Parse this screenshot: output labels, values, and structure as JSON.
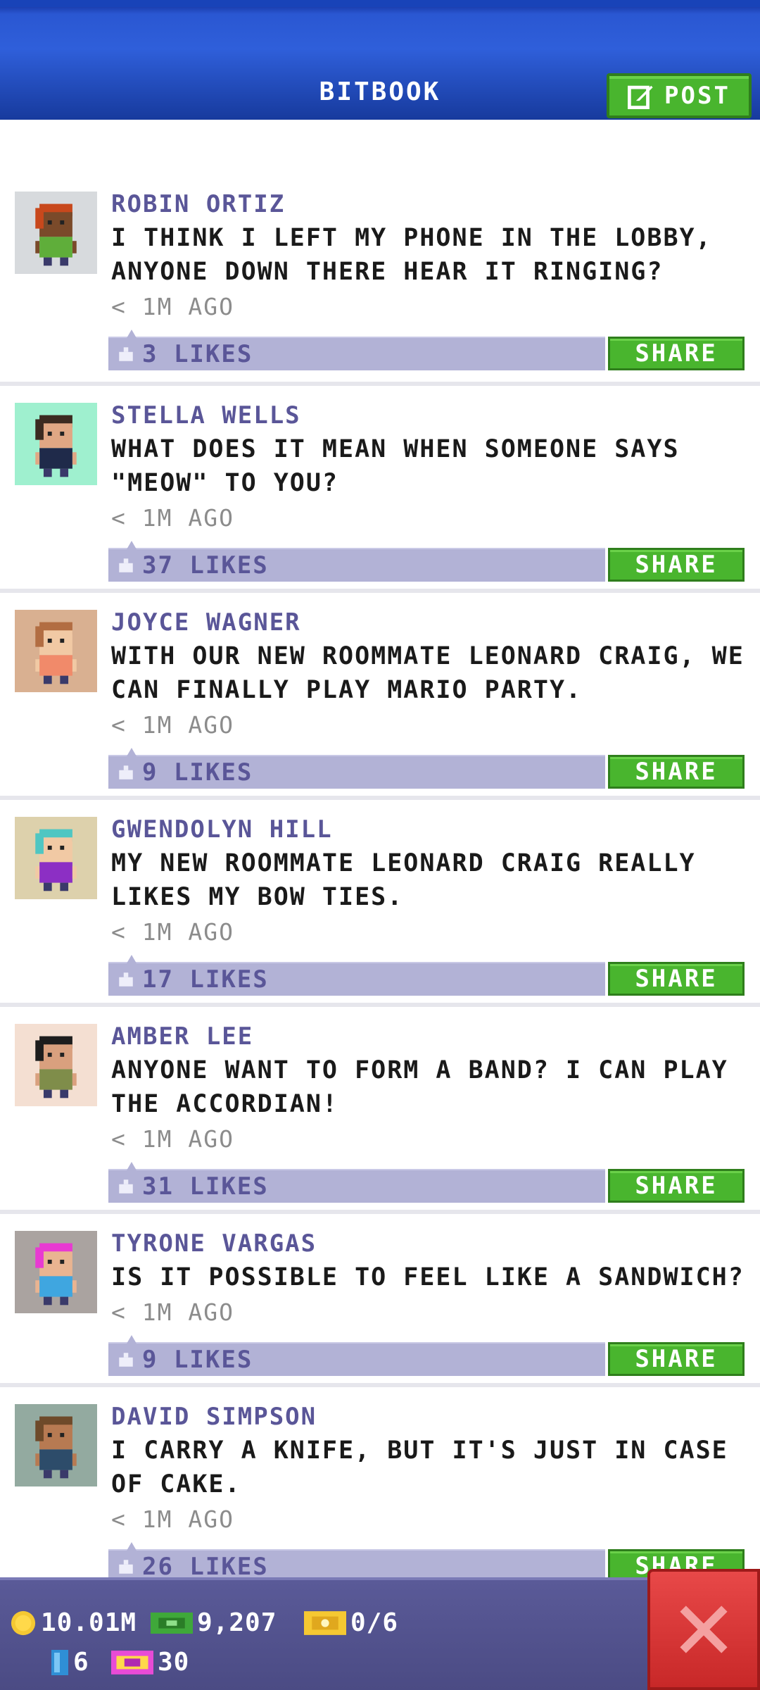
{
  "header": {
    "title": "BITBOOK",
    "post_label": "POST"
  },
  "share_label": "SHARE",
  "posts": [
    {
      "author": "ROBIN ORTIZ",
      "message": "I THINK I LEFT MY PHONE IN THE LOBBY, ANYONE DOWN THERE HEAR IT RINGING?",
      "time": "< 1M AGO",
      "likes": "3 LIKES",
      "avatar_bg": "#d7dadd",
      "hair": "#c8481c",
      "skin": "#7a4a2a",
      "shirt": "#5fae3a"
    },
    {
      "author": "STELLA WELLS",
      "message": "WHAT DOES IT MEAN WHEN SOMEONE SAYS \"MEOW\" TO YOU?",
      "time": "< 1M AGO",
      "likes": "37 LIKES",
      "avatar_bg": "#9ff0cf",
      "hair": "#3b2a20",
      "skin": "#e0a784",
      "shirt": "#1f2a4a"
    },
    {
      "author": "JOYCE WAGNER",
      "message": "WITH OUR NEW ROOMMATE LEONARD CRAIG, WE CAN FINALLY PLAY MARIO PARTY.",
      "time": "< 1M AGO",
      "likes": "9 LIKES",
      "avatar_bg": "#d9b091",
      "hair": "#b26d42",
      "skin": "#f1c9a4",
      "shirt": "#f18a6a"
    },
    {
      "author": "GWENDOLYN HILL",
      "message": "MY NEW ROOMMATE LEONARD CRAIG REALLY LIKES MY BOW TIES.",
      "time": "< 1M AGO",
      "likes": "17 LIKES",
      "avatar_bg": "#ddd1ac",
      "hair": "#4fc6c2",
      "skin": "#f1c9a4",
      "shirt": "#8c2fc4"
    },
    {
      "author": "AMBER LEE",
      "message": "ANYONE WANT TO FORM A BAND? I CAN PLAY THE ACCORDIAN!",
      "time": "< 1M AGO",
      "likes": "31 LIKES",
      "avatar_bg": "#f4dfd2",
      "hair": "#1d1d1d",
      "skin": "#d9a07e",
      "shirt": "#7f8d4a"
    },
    {
      "author": "TYRONE VARGAS",
      "message": "IS IT POSSIBLE TO FEEL LIKE A SANDWICH?",
      "time": "< 1M AGO",
      "likes": "9 LIKES",
      "avatar_bg": "#aaa3a0",
      "hair": "#e83ad2",
      "skin": "#e9b491",
      "shirt": "#3fa6e0"
    },
    {
      "author": "DAVID SIMPSON",
      "message": "I CARRY A KNIFE, BUT IT'S JUST IN CASE OF CAKE.",
      "time": "< 1M AGO",
      "likes": "26 LIKES",
      "avatar_bg": "#93aaa0",
      "hair": "#6e4a2a",
      "skin": "#b77a52",
      "shirt": "#2d4c6a"
    }
  ],
  "status": {
    "coins": "10.01M",
    "bux": "9,207",
    "tickets": "0/6",
    "keys": "6",
    "vip": "30"
  }
}
